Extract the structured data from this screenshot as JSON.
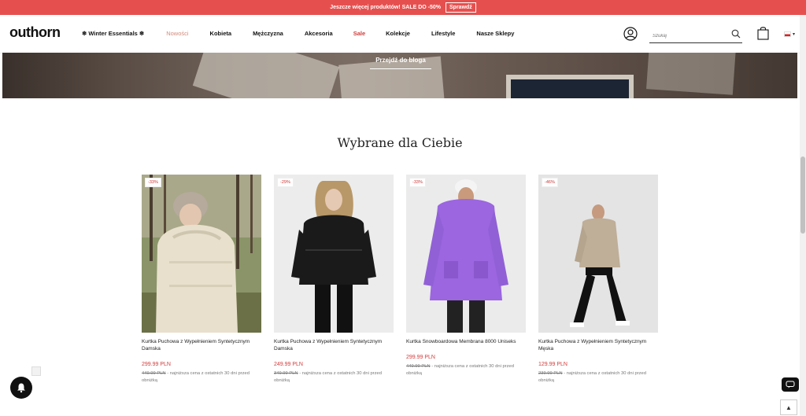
{
  "promo": {
    "text": "Jeszcze więcej produktów! SALE DO -50%",
    "cta": "Sprawdź"
  },
  "header": {
    "logo": "outhorn",
    "nav": [
      "❄ Winter Essentials ❄",
      "Nowości",
      "Kobieta",
      "Mężczyzna",
      "Akcesoria",
      "Sale",
      "Kolekcje",
      "Lifestyle",
      "Nasze Sklepy"
    ],
    "search_placeholder": "Szukaj"
  },
  "banner": {
    "cta": "Przejdź do bloga"
  },
  "section": {
    "title": "Wybrane dla Ciebie"
  },
  "products": [
    {
      "badge": "-33%",
      "name": "Kurtka Puchowa z Wypełnieniem Syntetycznym Damska",
      "price": "299.99 PLN",
      "prev_price": "449.99 PLN",
      "prev_note": " - najniższa cena z ostatnich 30 dni przed obniżką"
    },
    {
      "badge": "-29%",
      "name": "Kurtka Puchowa z Wypełnieniem Syntetycznym Damska",
      "price": "249.99 PLN",
      "prev_price": "349.99 PLN",
      "prev_note": " - najniższa cena z ostatnich 30 dni przed obniżką"
    },
    {
      "badge": "-33%",
      "name": "Kurtka Snowboardowa Membrana 8000 Uniseks",
      "price": "299.99 PLN",
      "prev_price": "449.99 PLN",
      "prev_note": " - najniższa cena z ostatnich 30 dni przed obniżką"
    },
    {
      "badge": "-46%",
      "name": "Kurtka Puchowa z Wypełnieniem Syntetycznym Męska",
      "price": "129.99 PLN",
      "prev_price": "239.99 PLN",
      "prev_note": " - najniższa cena z ostatnich 30 dni przed obniżką"
    }
  ],
  "colors": {
    "promo": "#e5504f",
    "sale": "#d23c3c",
    "new": "#d48a7a"
  },
  "icons": [
    "user-icon",
    "search-icon",
    "bag-icon",
    "flag-icon",
    "bell-icon",
    "chat-icon",
    "arrow-up-icon"
  ]
}
